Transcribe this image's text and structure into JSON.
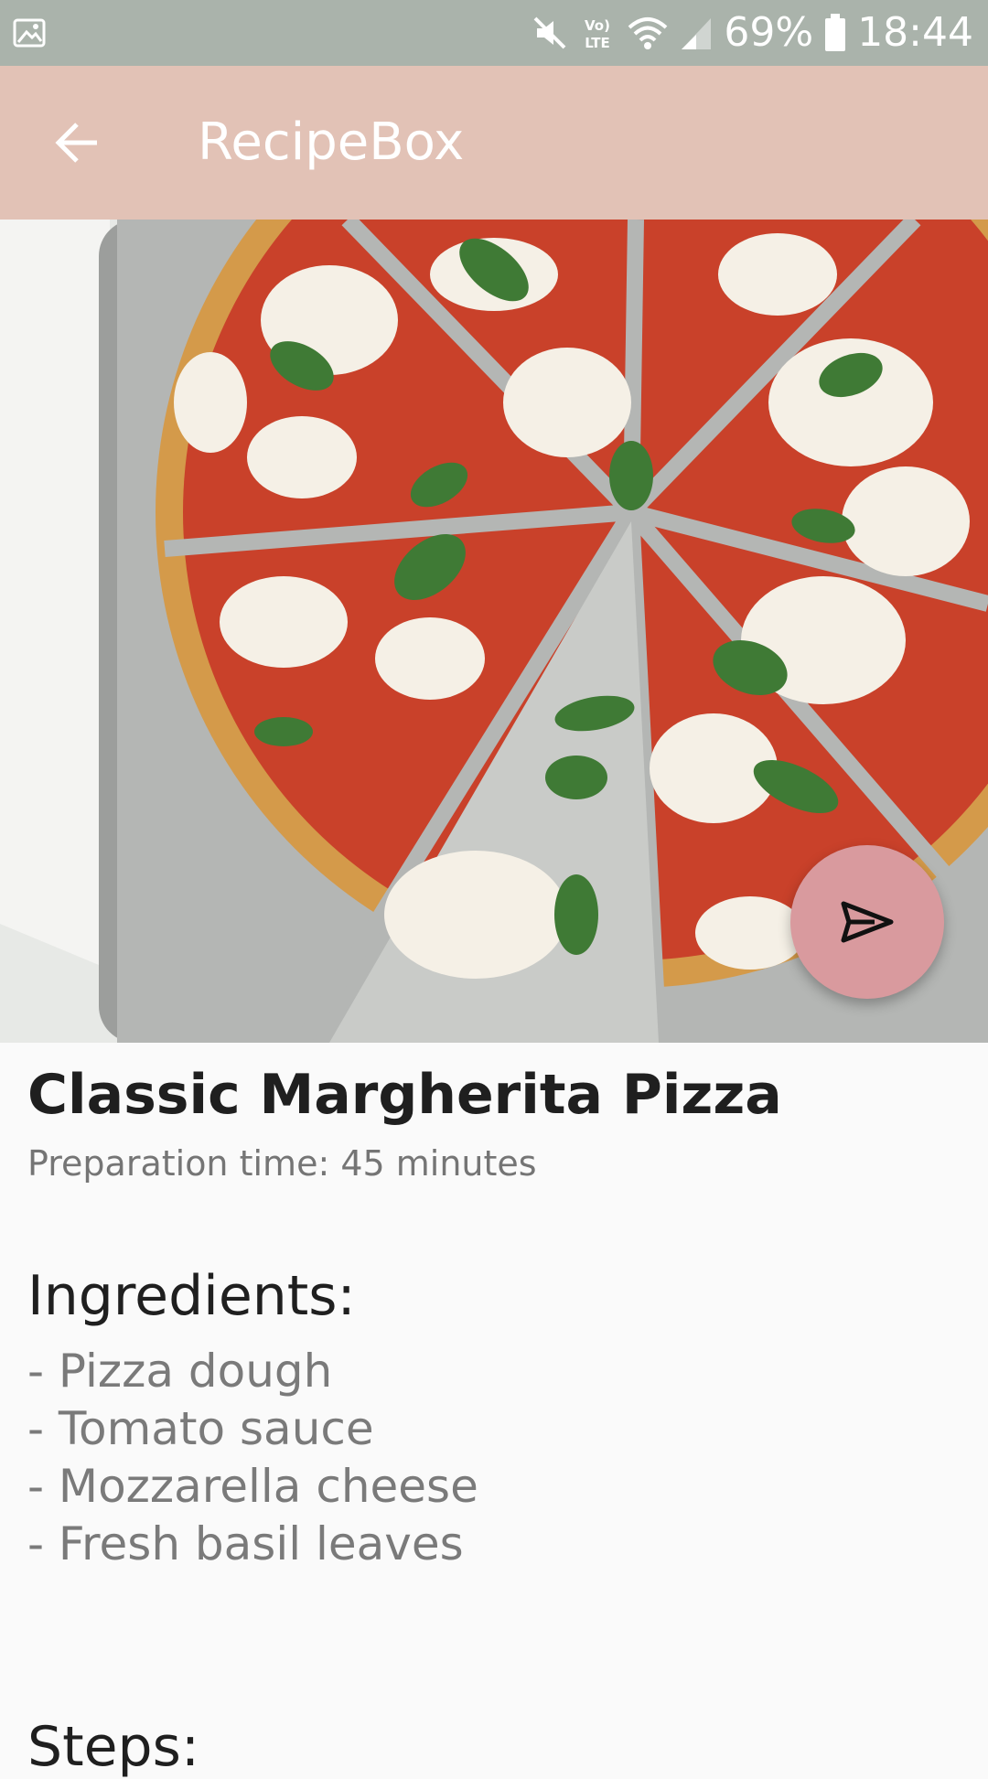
{
  "status_bar": {
    "battery_percent": "69%",
    "time": "18:44",
    "icons": [
      "gallery-icon",
      "mute-icon",
      "volte-icon",
      "wifi-icon",
      "signal-icon",
      "battery-icon"
    ]
  },
  "app_bar": {
    "back_icon": "arrow-left-icon",
    "title": "RecipeBox"
  },
  "hero": {
    "image": "margherita-pizza-photo"
  },
  "fab": {
    "icon": "send-icon"
  },
  "recipe": {
    "title": "Classic Margherita Pizza",
    "prep_time": "Preparation time: 45 minutes",
    "ingredients_heading": "Ingredients:",
    "ingredients": [
      "- Pizza dough",
      "- Tomato sauce",
      "- Mozzarella cheese",
      "- Fresh basil leaves"
    ],
    "steps_heading": "Steps:"
  },
  "colors": {
    "status_bar": "#aab3ab",
    "app_bar": "#e2c2b6",
    "fab": "#d99a9e",
    "background": "#fafafa",
    "title_text": "#1f1f1f",
    "secondary_text": "#757575"
  }
}
